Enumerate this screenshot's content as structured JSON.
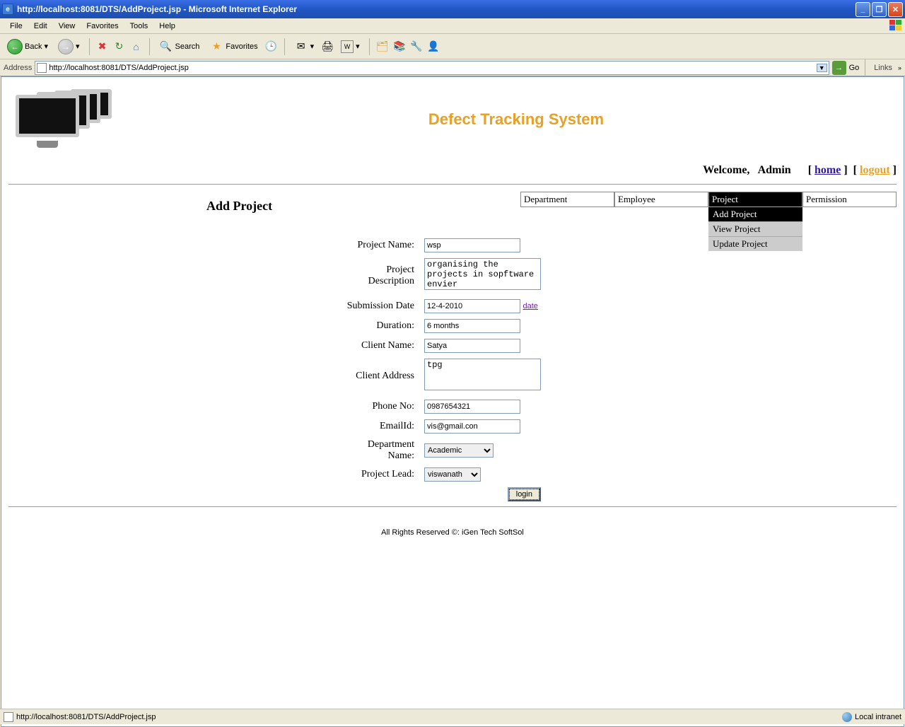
{
  "window": {
    "title": "http://localhost:8081/DTS/AddProject.jsp - Microsoft Internet Explorer"
  },
  "menubar": {
    "file": "File",
    "edit": "Edit",
    "view": "View",
    "favorites": "Favorites",
    "tools": "Tools",
    "help": "Help"
  },
  "toolbar": {
    "back": "Back",
    "search": "Search",
    "favorites": "Favorites"
  },
  "addressbar": {
    "label": "Address",
    "url": "http://localhost:8081/DTS/AddProject.jsp",
    "go": "Go",
    "links": "Links"
  },
  "page": {
    "app_title": "Defect Tracking System",
    "welcome": "Welcome,",
    "user": "Admin",
    "home": "home",
    "logout": "logout",
    "section_title": "Add Project",
    "nav": {
      "department": "Department",
      "employee": "Employee",
      "project": "Project",
      "permission": "Permission",
      "dd_add": "Add Project",
      "dd_view": "View Project",
      "dd_update": "Update Project"
    },
    "form": {
      "labels": {
        "project_name": "Project Name:",
        "project_desc": "Project Description",
        "submission_date": "Submission Date",
        "duration": "Duration:",
        "client_name": "Client Name:",
        "client_address": "Client Address",
        "phone": "Phone No:",
        "email": "EmailId:",
        "dept_name": "Department Name:",
        "project_lead": "Project Lead:"
      },
      "values": {
        "project_name": "wsp",
        "project_desc": "organising the projects in sopftware envier",
        "submission_date": "12-4-2010",
        "duration": "6 months",
        "client_name": "Satya",
        "client_address": "tpg",
        "phone": "0987654321",
        "email": "vis@gmail.con",
        "dept_name": "Academic",
        "project_lead": "viswanath"
      },
      "date_link": "date",
      "submit": "login"
    },
    "footer": "All Rights Reserved ©: iGen Tech SoftSol"
  },
  "statusbar": {
    "left": "http://localhost:8081/DTS/AddProject.jsp",
    "zone": "Local intranet"
  }
}
